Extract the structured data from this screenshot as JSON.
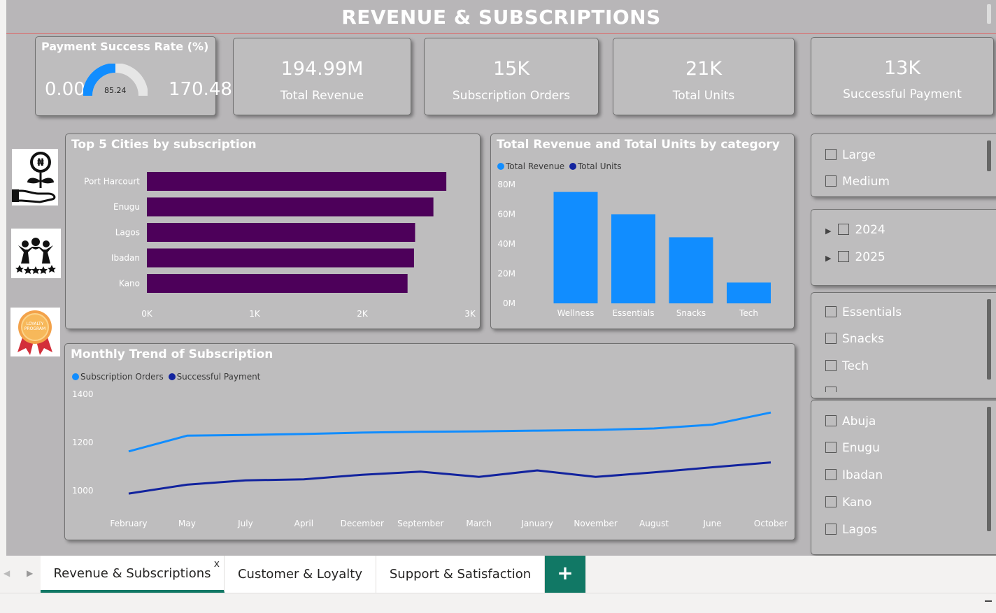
{
  "header": {
    "title": "REVENUE & SUBSCRIPTIONS"
  },
  "gauge": {
    "title": "Payment Success Rate (%)",
    "min": "0.00",
    "max": "170.48",
    "value_label": "85.24",
    "value": 85.24,
    "min_value": 0,
    "max_value": 170.48
  },
  "kpis": [
    {
      "value": "194.99M",
      "label": "Total Revenue"
    },
    {
      "value": "15K",
      "label": "Subscription Orders"
    },
    {
      "value": "21K",
      "label": "Total Units"
    },
    {
      "value": "13K",
      "label": "Successful Payment"
    }
  ],
  "icons": [
    "naira-hand-plant-icon",
    "community-stars-icon",
    "loyalty-program-badge-icon"
  ],
  "loyalty_badge_text": "LOYALTY PROGRAM",
  "charts": {
    "cities": {
      "title": "Top 5 Cities by subscription"
    },
    "category": {
      "title": "Total Revenue and Total Units by category",
      "legend": [
        "Total Revenue",
        "Total Units"
      ]
    },
    "monthly": {
      "title": "Monthly Trend of Subscription",
      "legend": [
        "Subscription Orders",
        "Successful Payment"
      ]
    }
  },
  "slicers": {
    "size": [
      "Large",
      "Medium"
    ],
    "year": [
      "2024",
      "2025"
    ],
    "category": [
      "Essentials",
      "Snacks",
      "Tech"
    ],
    "city": [
      "Abuja",
      "Enugu",
      "Ibadan",
      "Kano",
      "Lagos"
    ]
  },
  "tabs": {
    "active": "Revenue & Subscriptions",
    "close": "x",
    "items": [
      "Customer & Loyalty",
      "Support & Satisfaction"
    ],
    "add": "+"
  },
  "colors": {
    "bar_purple": "#4d005a",
    "blue": "#118dff",
    "navy": "#12239e",
    "accent_green": "#117865",
    "background": "#b8b6b8"
  },
  "chart_data": [
    {
      "type": "bar",
      "orientation": "horizontal",
      "title": "Top 5 Cities by subscription",
      "categories": [
        "Port Harcourt",
        "Enugu",
        "Lagos",
        "Ibadan",
        "Kano"
      ],
      "values": [
        2780,
        2660,
        2490,
        2480,
        2420
      ],
      "xticks": [
        "0K",
        "1K",
        "2K",
        "3K"
      ],
      "xlim": [
        0,
        3000
      ],
      "color": "#4d005a"
    },
    {
      "type": "bar",
      "title": "Total Revenue and Total Units by category",
      "categories": [
        "Wellness",
        "Essentials",
        "Snacks",
        "Tech"
      ],
      "series": [
        {
          "name": "Total Revenue",
          "values": [
            75000000,
            60000000,
            44500000,
            14000000
          ]
        },
        {
          "name": "Total Units",
          "values": [
            0,
            0,
            0,
            0
          ]
        }
      ],
      "yticks": [
        "0M",
        "20M",
        "40M",
        "60M",
        "80M"
      ],
      "ylim": [
        0,
        80000000
      ],
      "legend": "top-left"
    },
    {
      "type": "line",
      "title": "Monthly Trend of Subscription",
      "x": [
        "February",
        "May",
        "July",
        "April",
        "December",
        "September",
        "March",
        "January",
        "November",
        "August",
        "June",
        "October"
      ],
      "series": [
        {
          "name": "Subscription Orders",
          "values": [
            1163,
            1228,
            1231,
            1235,
            1241,
            1244,
            1246,
            1249,
            1252,
            1258,
            1274,
            1324
          ]
        },
        {
          "name": "Successful Payment",
          "values": [
            988,
            1025,
            1043,
            1047,
            1066,
            1079,
            1057,
            1084,
            1057,
            1076,
            1097,
            1117
          ]
        }
      ],
      "yticks": [
        "1000",
        "1200",
        "1400"
      ],
      "ylim": [
        930,
        1400
      ],
      "legend": "top-left"
    }
  ]
}
